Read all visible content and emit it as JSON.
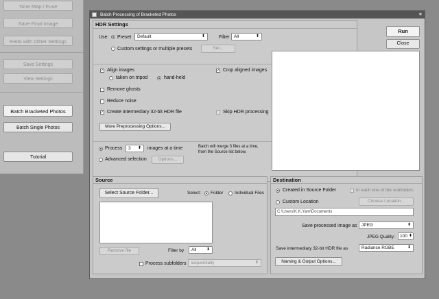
{
  "left_panel": {
    "tone_map": "Tone Map / Fuse",
    "save_final": "Save Final Image",
    "redo_other": "Redo with Other Settings",
    "save_settings": "Save Settings",
    "view_settings": "View Settings",
    "batch_bracketed": "Batch Bracketed Photos",
    "batch_single": "Batch Single Photos",
    "tutorial": "Tutorial"
  },
  "dialog": {
    "title": "Batch Processing of Bracketed Photos",
    "close": "×",
    "run": "Run",
    "close_button": "Close",
    "hdr": {
      "heading": "HDR Settings",
      "use_label": "Use:",
      "preset_label": "Preset",
      "preset_value": "Default",
      "filter_label": "Filter",
      "filter_value": "All",
      "custom_label": "Custom settings or multiple presets",
      "set_button": "Set...",
      "align_images": "Align images",
      "taken_on_tripod": "taken on tripod",
      "hand_held": "hand-held",
      "crop_aligned": "Crop aligned images",
      "remove_ghosts": "Remove ghosts",
      "reduce_noise": "Reduce noise",
      "create_32bit": "Create intermediary 32-bit HDR file",
      "skip_hdr": "Skip HDR processing",
      "more_options": "More Preprocessing Options...",
      "process_label": "Process",
      "process_value": "3",
      "images_at_a_time": "images at a time",
      "merge_note_1": "Batch will merge 3 files at a time,",
      "merge_note_2": "from the Source list below.",
      "advanced_selection": "Advanced selection",
      "options_button": "Options..."
    },
    "source": {
      "heading": "Source",
      "select_folder_button": "Select Source Folder...",
      "select_label": "Select:",
      "folder_option": "Folder",
      "individual_files_option": "Individual Files",
      "remove_file_button": "Remove file",
      "filter_by_label": "Filter by",
      "filter_by_value": "All",
      "process_subfolders": "Process subfolders",
      "subfolder_mode": "sequentially"
    },
    "destination": {
      "heading": "Destination",
      "created_in_source": "Created in Source Folder",
      "in_each_subfolder": "In each one of the subfolders",
      "custom_location": "Custom Location",
      "choose_location": "Choose Location...",
      "path": "C:\\Users\\K.K.Yam\\Documents",
      "save_processed_label": "Save processed image as",
      "save_processed_value": "JPEG",
      "jpeg_quality_label": "JPEG Quality:",
      "jpeg_quality_value": "100",
      "save_intermediary_label": "Save intermediary 32-bit HDR file as",
      "save_intermediary_value": "Radiance RGBE",
      "naming_button": "Naming & Output Options..."
    }
  }
}
